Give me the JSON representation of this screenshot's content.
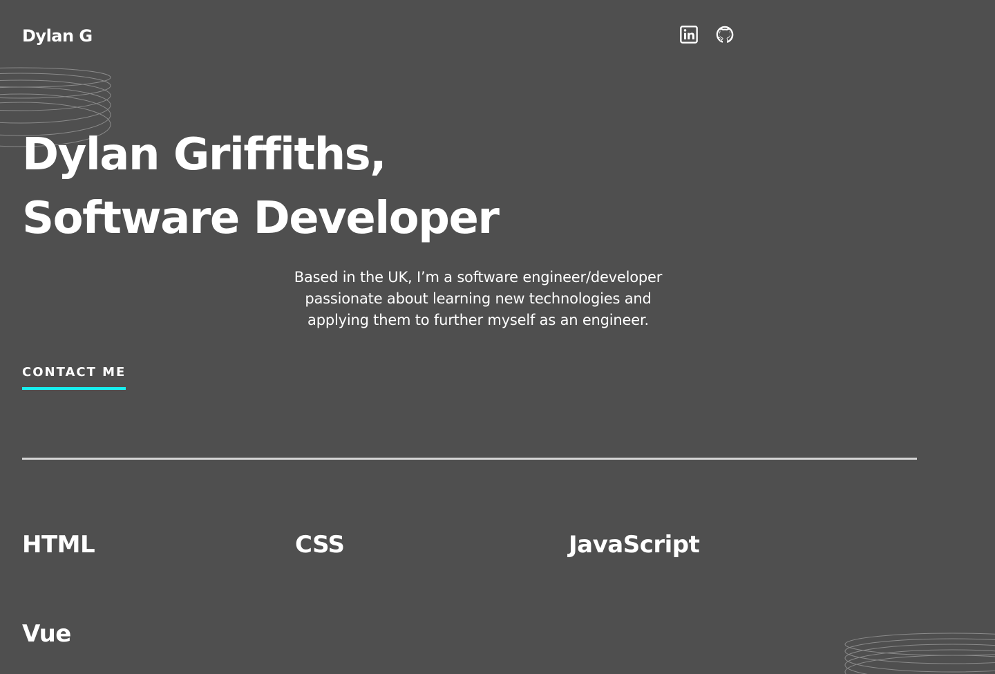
{
  "header": {
    "logo": "Dylan G",
    "social": [
      {
        "name": "linkedin-icon"
      },
      {
        "name": "github-icon"
      }
    ]
  },
  "hero": {
    "name": "Dylan Griffiths",
    "name_suffix": ",",
    "role": "Software Developer",
    "intro_lines": [
      "Based in the UK, I’m a software engineer/developer",
      "passionate about learning new technologies and",
      "applying them to further myself as an engineer."
    ],
    "contact_label": "CONTACT ME"
  },
  "skills": [
    "HTML",
    "CSS",
    "JavaScript",
    "Vue"
  ],
  "colors": {
    "background": "#4f4f4f",
    "text": "#ffffff",
    "accent": "#18f0f0",
    "divider": "#d6d6d6"
  }
}
